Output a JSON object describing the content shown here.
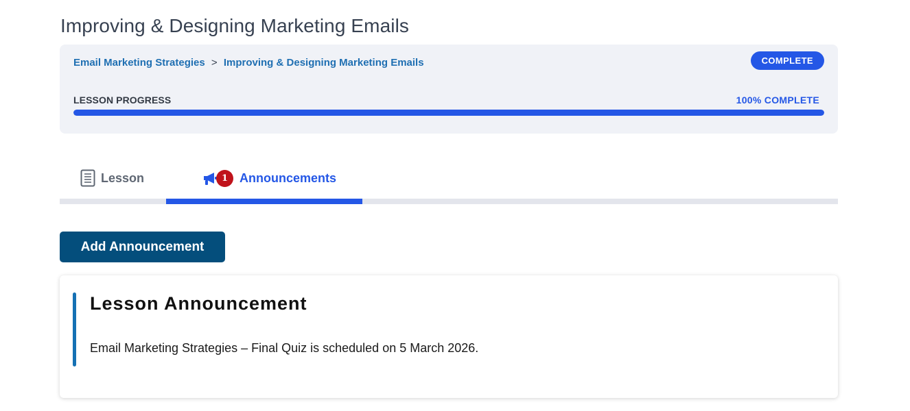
{
  "page": {
    "title": "Improving & Designing Marketing Emails"
  },
  "breadcrumb": {
    "course": "Email Marketing Strategies",
    "separator": ">",
    "lesson": "Improving & Designing Marketing Emails"
  },
  "status_badge": "COMPLETE",
  "progress": {
    "label": "LESSON PROGRESS",
    "value_text": "100% COMPLETE",
    "percent": 100
  },
  "tabs": [
    {
      "label": "Lesson",
      "icon": "document-icon",
      "active": false
    },
    {
      "label": "Announcements",
      "icon": "megaphone-icon",
      "active": true,
      "badge_count": "1"
    }
  ],
  "actions": {
    "add_announcement": "Add Announcement"
  },
  "announcement": {
    "title": "Lesson Announcement",
    "body": "Email Marketing Strategies – Final Quiz is scheduled on 5 March 2026."
  },
  "colors": {
    "accent": "#2457e6",
    "button": "#044e7c",
    "breadcrumb": "#1f6fb2",
    "badge_red": "#c0131b",
    "card_accent": "#1571b4"
  }
}
